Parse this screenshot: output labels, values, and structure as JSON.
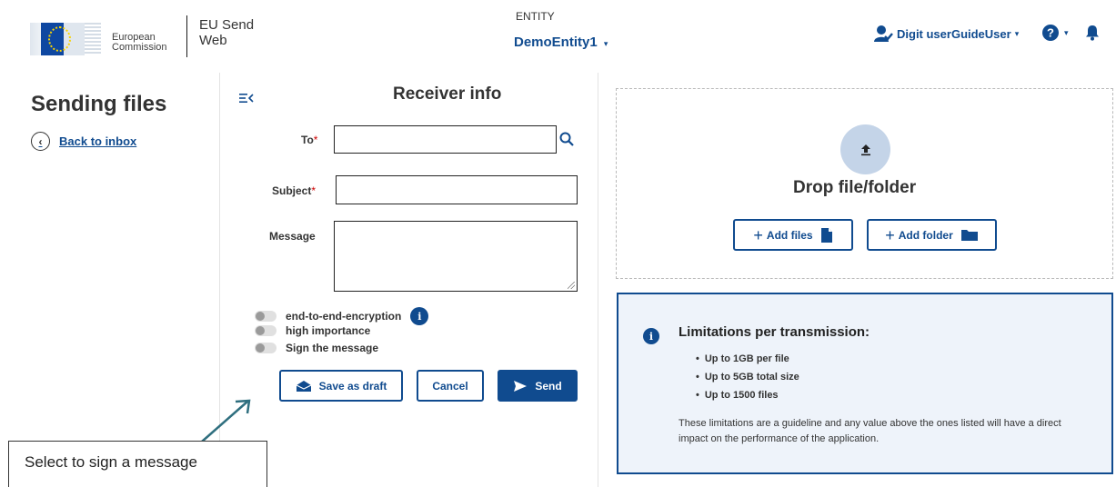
{
  "header": {
    "logo_line1": "European",
    "logo_line2": "Commission",
    "app_line1": "EU Send",
    "app_line2": "Web",
    "entity_label": "ENTITY",
    "entity_value": "DemoEntity1",
    "user_name": "Digit userGuideUser"
  },
  "sidebar": {
    "title": "Sending files",
    "back_link": "Back to inbox"
  },
  "form": {
    "section_title": "Receiver info",
    "to_label": "To",
    "subject_label": "Subject",
    "message_label": "Message",
    "required_mark": "*",
    "to_value": "",
    "subject_value": "",
    "message_value": "",
    "toggles": [
      {
        "label": "end-to-end-encryption",
        "on": false
      },
      {
        "label": "high importance",
        "on": false
      },
      {
        "label": "Sign the message",
        "on": false
      }
    ],
    "info_glyph": "i",
    "save_draft_label": "Save as draft",
    "cancel_label": "Cancel",
    "send_label": "Send"
  },
  "callout": {
    "text": "Select to sign a message"
  },
  "upload": {
    "drop_title": "Drop file/folder",
    "add_files_label": "Add files",
    "add_folder_label": "Add folder",
    "plus": "+"
  },
  "limitations": {
    "title": "Limitations per transmission:",
    "items": [
      "Up to 1GB per file",
      "Up to 5GB total size",
      "Up to 1500 files"
    ],
    "note": "These limitations are a guideline and any value above the ones listed will have a direct impact on the performance of the application."
  },
  "colors": {
    "primary": "#104b8f",
    "highlight": "#a9bfe0",
    "panel_bg": "#eef3fa"
  },
  "icons": [
    "user-check-icon",
    "help-icon",
    "bell-icon",
    "collapse-icon",
    "search-icon",
    "envelope-open-icon",
    "send-icon",
    "upload-icon",
    "file-icon",
    "folder-icon",
    "info-icon",
    "back-arrow-icon"
  ]
}
